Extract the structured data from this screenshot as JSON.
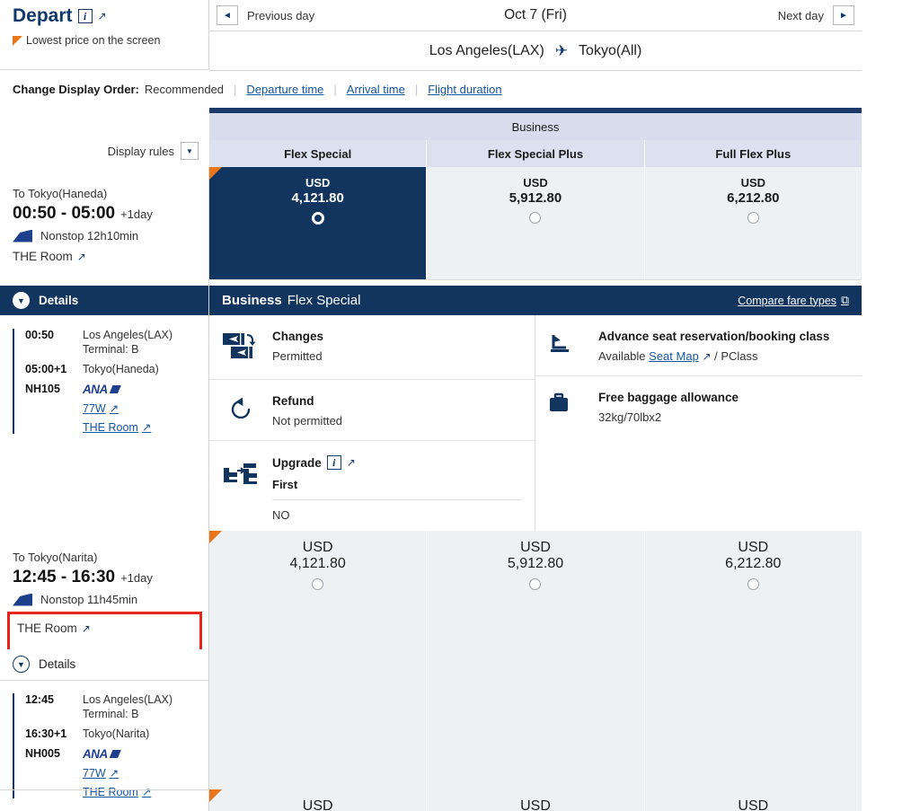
{
  "header": {
    "depart_title": "Depart",
    "info_icon": "info-icon",
    "external_icon": "external-link-icon",
    "lowest_price_note": "Lowest price on the screen",
    "prev_day": "Previous day",
    "next_day": "Next day",
    "date": "Oct 7 (Fri)",
    "origin": "Los Angeles(LAX)",
    "destination": "Tokyo(All)",
    "plane_icon": "airplane-icon"
  },
  "sort": {
    "label": "Change Display Order:",
    "current": "Recommended",
    "options": [
      "Departure time",
      "Arrival time",
      "Flight duration"
    ]
  },
  "display_rules": {
    "label": "Display rules",
    "chevron_icon": "chevron-down-icon"
  },
  "fare_table": {
    "cabin": "Business",
    "columns": [
      "Flex Special",
      "Flex Special Plus",
      "Full Flex Plus"
    ]
  },
  "flights": [
    {
      "dest_label": "To Tokyo(Haneda)",
      "times": "00:50 - 05:00",
      "day_offset": "+1day",
      "stops": "Nonstop 12h10min",
      "room_label": "THE Room",
      "room_highlighted": false,
      "details_label": "Details",
      "details_expanded": true,
      "segment": {
        "dep_time": "00:50",
        "dep_airport": "Los Angeles(LAX)",
        "terminal": "Terminal: B",
        "arr_time": "05:00+1",
        "arr_airport": "Tokyo(Haneda)",
        "flight_no": "NH105",
        "carrier": "ANA",
        "aircraft": "77W",
        "product": "THE Room"
      },
      "prices": [
        {
          "currency": "USD",
          "amount": "4,121.80",
          "selected": true,
          "lowest": true
        },
        {
          "currency": "USD",
          "amount": "5,912.80",
          "selected": false,
          "lowest": false
        },
        {
          "currency": "USD",
          "amount": "6,212.80",
          "selected": false,
          "lowest": false
        }
      ]
    },
    {
      "dest_label": "To Tokyo(Narita)",
      "times": "12:45 - 16:30",
      "day_offset": "+1day",
      "stops": "Nonstop 11h45min",
      "room_label": "THE Room",
      "room_highlighted": true,
      "details_label": "Details",
      "details_expanded": false,
      "segment": {
        "dep_time": "12:45",
        "dep_airport": "Los Angeles(LAX)",
        "terminal": "Terminal: B",
        "arr_time": "16:30+1",
        "arr_airport": "Tokyo(Narita)",
        "flight_no": "NH005",
        "carrier": "ANA",
        "aircraft": "77W",
        "product": "THE Room"
      },
      "prices": [
        {
          "currency": "USD",
          "amount": "4,121.80",
          "selected": false,
          "lowest": true
        },
        {
          "currency": "USD",
          "amount": "5,912.80",
          "selected": false,
          "lowest": false
        },
        {
          "currency": "USD",
          "amount": "6,212.80",
          "selected": false,
          "lowest": false
        }
      ]
    }
  ],
  "fare_detail": {
    "cabin": "Business",
    "fare_name": "Flex Special",
    "compare_link": "Compare fare types",
    "compare_icon": "external-window-icon",
    "changes": {
      "icon": "flight-change-icon",
      "title": "Changes",
      "value": "Permitted"
    },
    "refund": {
      "icon": "refund-arrow-icon",
      "title": "Refund",
      "value": "Not permitted"
    },
    "upgrade": {
      "icon": "seat-upgrade-icon",
      "title": "Upgrade",
      "info_icon": "info-icon",
      "external_icon": "external-link-icon",
      "sub_title": "First",
      "value": "NO"
    },
    "seat": {
      "icon": "seat-icon",
      "title": "Advance seat reservation/booking class",
      "available": "Available",
      "seat_map_link": "Seat Map",
      "booking_class": "/ PClass"
    },
    "baggage": {
      "icon": "baggage-icon",
      "title": "Free baggage allowance",
      "value": "32kg/70lbx2"
    }
  },
  "colors": {
    "brand_navy": "#123560",
    "accent_orange": "#e8751a",
    "link_blue": "#1455a0",
    "highlight_red": "#e8231a",
    "cell_grey": "#eef1f4",
    "header_lavender": "#dde1ef"
  }
}
